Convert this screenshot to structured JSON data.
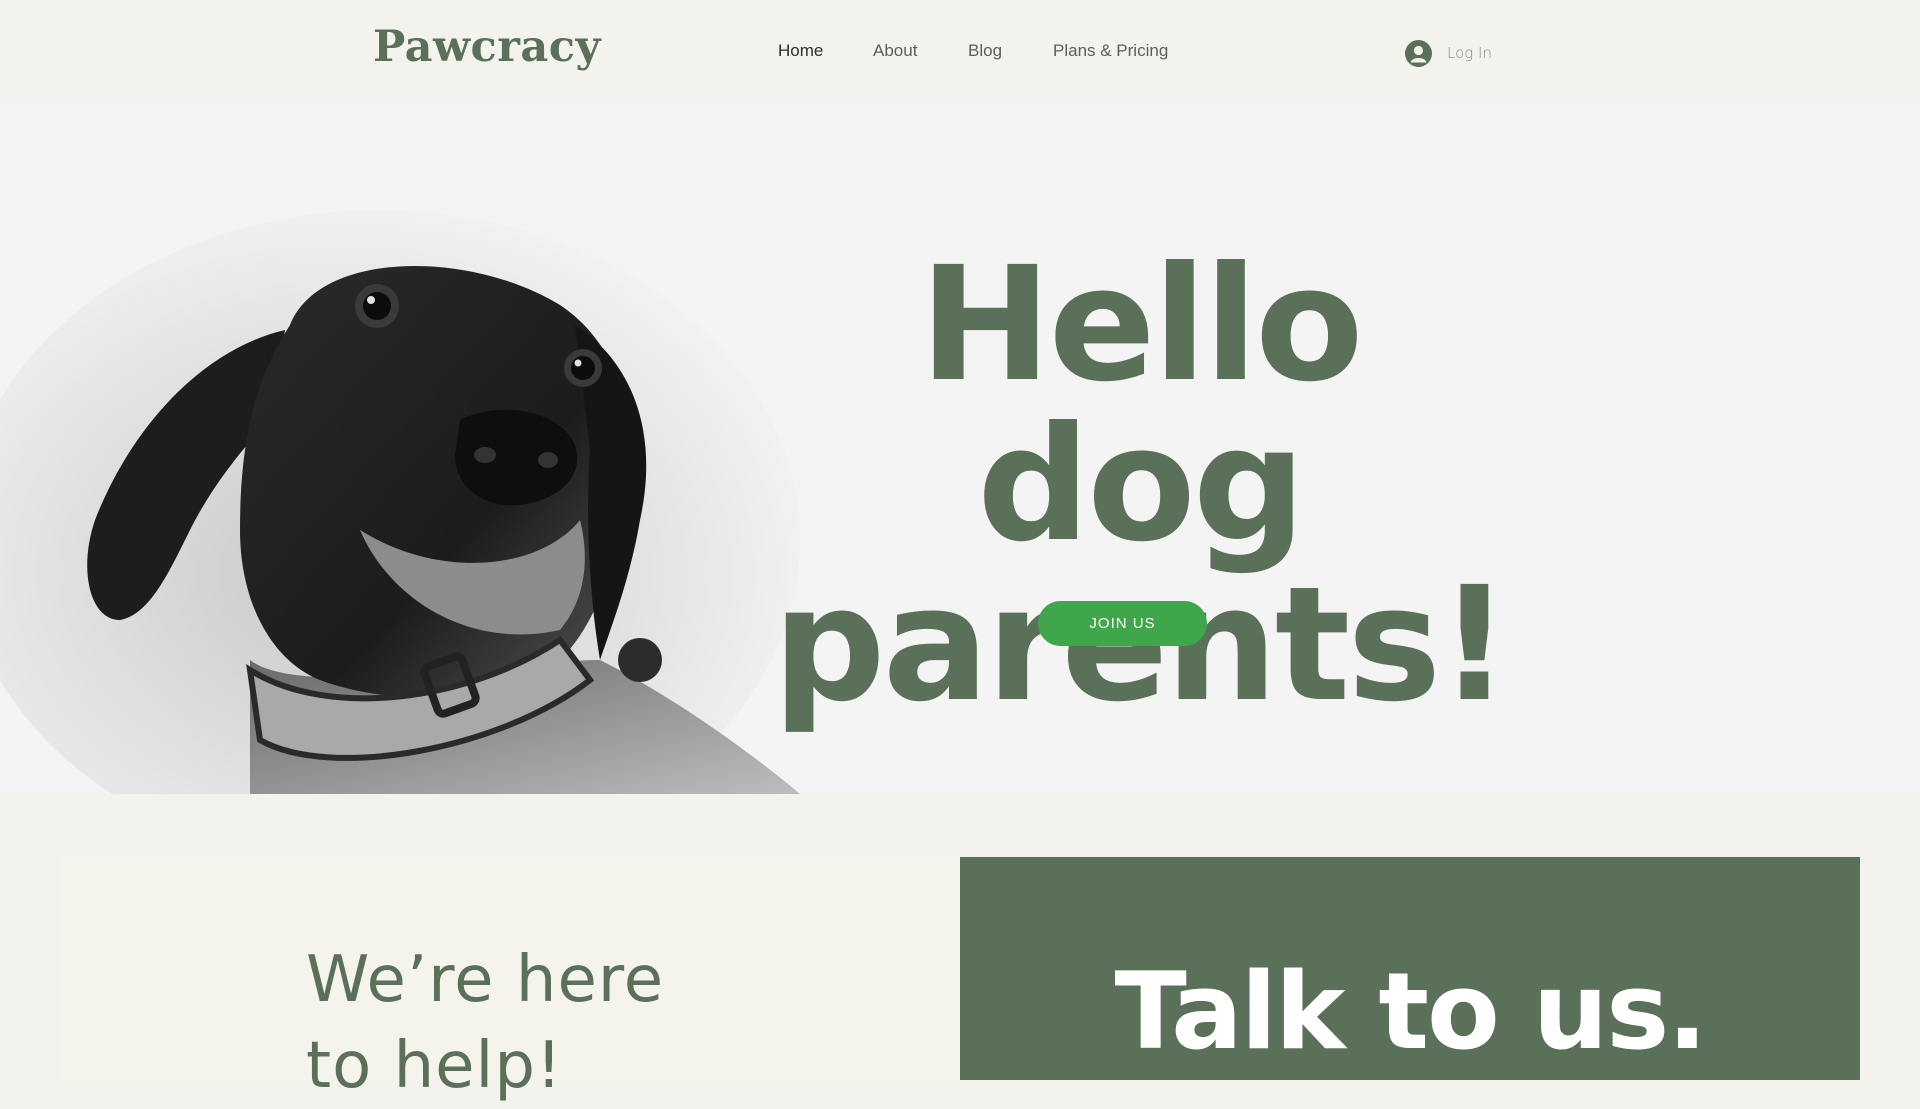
{
  "header": {
    "logo_text": "Pawcracy",
    "nav": [
      {
        "label": "Home",
        "active": true
      },
      {
        "label": "About",
        "active": false
      },
      {
        "label": "Blog",
        "active": false
      },
      {
        "label": "Plans & Pricing",
        "active": false
      }
    ],
    "login": {
      "label": "Log In",
      "icon": "user-avatar-icon"
    }
  },
  "hero": {
    "title_line1": "Hello dog",
    "title_line2": "parents!",
    "cta_label": "JOIN US",
    "image": "black-and-white-dog-photo"
  },
  "sections": {
    "help_line1": "We’re here",
    "help_line2": "to help!",
    "talk_title": "Talk to us."
  },
  "colors": {
    "brand_green": "#5b7058",
    "cta_green": "#3fa64b",
    "page_bg": "#f3f2ed",
    "hero_bg": "#f4f4f4"
  }
}
